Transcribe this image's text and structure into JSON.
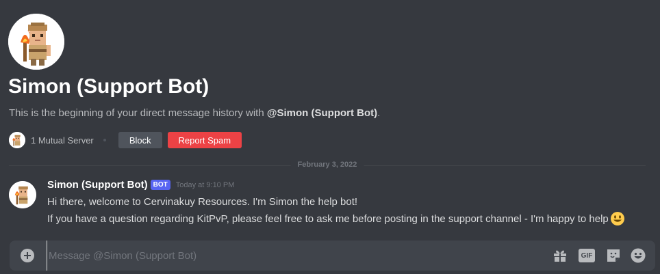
{
  "profile": {
    "name": "Simon (Support Bot)",
    "intro_prefix": "This is the beginning of your direct message history with ",
    "intro_handle": "@Simon (Support Bot)",
    "intro_suffix": ".",
    "mutual_servers": "1 Mutual Server",
    "block_label": "Block",
    "report_label": "Report Spam"
  },
  "divider": {
    "date": "February 3, 2022"
  },
  "message": {
    "author": "Simon (Support Bot)",
    "tag": "BOT",
    "timestamp": "Today at 9:10 PM",
    "line1": "Hi there, welcome to Cervinakuy Resources. I'm Simon the help bot!",
    "line2": "If you have a question regarding KitPvP, please feel free to ask me before posting in the support channel - I'm happy to help",
    "emoji": "smiley-emoji"
  },
  "composer": {
    "placeholder": "Message @Simon (Support Bot)",
    "value": "",
    "gif_label": "GIF",
    "icons": [
      "add-attachment-icon",
      "gift-icon",
      "gif-icon",
      "sticker-icon",
      "emoji-picker-icon"
    ]
  },
  "colors": {
    "background": "#36393f",
    "composer": "#40444b",
    "danger": "#ed4245",
    "bot_tag": "#5865f2",
    "secondary_button": "#4f545c"
  }
}
